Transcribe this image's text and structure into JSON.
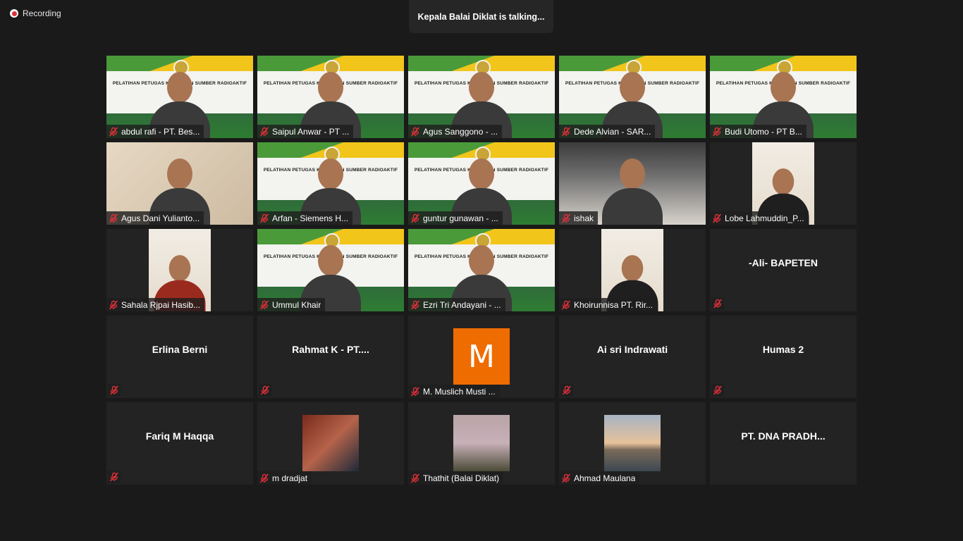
{
  "recording": {
    "label": "Recording"
  },
  "speaker_banner": {
    "text": "Kepala Balai Diklat  is talking..."
  },
  "slide_text": "PELATIHAN PETUGAS KEAMANAN SUMBER RADIOAKTIF",
  "colors": {
    "mute_red": "#e0303a",
    "tile_bg": "#232323",
    "avatar_orange": "#ef6c00"
  },
  "tiles": [
    {
      "name": "abdul rafi - PT. Bes...",
      "kind": "video",
      "bg": "slide"
    },
    {
      "name": "Saipul Anwar - PT ...",
      "kind": "video",
      "bg": "slide"
    },
    {
      "name": "Agus Sanggono - ...",
      "kind": "video",
      "bg": "slide"
    },
    {
      "name": "Dede Alvian - SAR...",
      "kind": "video",
      "bg": "slide"
    },
    {
      "name": "Budi Utomo - PT B...",
      "kind": "video",
      "bg": "slide"
    },
    {
      "name": "Agus Dani Yulianto...",
      "kind": "video",
      "bg": "wall"
    },
    {
      "name": "Arfan - Siemens H...",
      "kind": "video",
      "bg": "slide"
    },
    {
      "name": "guntur gunawan - ...",
      "kind": "video",
      "bg": "slide"
    },
    {
      "name": "ishak",
      "kind": "video",
      "bg": "car"
    },
    {
      "name": "Lobe Lahmuddin_P...",
      "kind": "portrait"
    },
    {
      "name": "Sahala Rjpai Hasib...",
      "kind": "portrait"
    },
    {
      "name": "Ummul Khair",
      "kind": "video",
      "bg": "slide"
    },
    {
      "name": "Ezri Tri Andayani - ...",
      "kind": "video",
      "bg": "slide"
    },
    {
      "name": "Khoirunnisa PT. Rir...",
      "kind": "portrait"
    },
    {
      "name": "-Ali- BAPETEN",
      "kind": "name"
    },
    {
      "name": "Erlina Berni",
      "kind": "name"
    },
    {
      "name": "Rahmat K - PT....",
      "kind": "name"
    },
    {
      "name": "M. Muslich Musti ...",
      "kind": "avatar",
      "initial": "M"
    },
    {
      "name": "Ai sri Indrawati",
      "kind": "name"
    },
    {
      "name": "Humas 2",
      "kind": "name"
    },
    {
      "name": "Fariq M Haqqa",
      "kind": "name"
    },
    {
      "name": "m dradjat",
      "kind": "photo",
      "photo": "headset"
    },
    {
      "name": "Thathit (Balai Diklat)",
      "kind": "photo",
      "photo": "family"
    },
    {
      "name": "Ahmad Maulana",
      "kind": "photo",
      "photo": "sunset"
    },
    {
      "name": "PT. DNA PRADH...",
      "kind": "name-nomute"
    }
  ]
}
